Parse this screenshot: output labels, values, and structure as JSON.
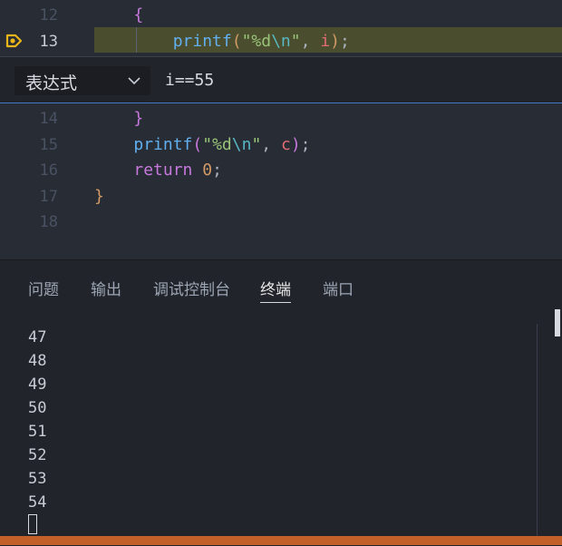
{
  "editor": {
    "lines_top": [
      {
        "num": "12",
        "tokens": [
          {
            "t": "    ",
            "c": "t-plain"
          },
          {
            "t": "{",
            "c": "t-br1"
          }
        ]
      },
      {
        "num": "13",
        "tokens": [
          {
            "t": "        ",
            "c": "t-plain"
          },
          {
            "t": "printf",
            "c": "t-fn"
          },
          {
            "t": "(",
            "c": "t-br2"
          },
          {
            "t": "\"%d",
            "c": "t-str"
          },
          {
            "t": "\\n",
            "c": "t-esc"
          },
          {
            "t": "\"",
            "c": "t-str"
          },
          {
            "t": ", ",
            "c": "t-plain"
          },
          {
            "t": "i",
            "c": "t-var"
          },
          {
            "t": ")",
            "c": "t-br2"
          },
          {
            "t": ";",
            "c": "t-plain"
          }
        ]
      }
    ],
    "lines_bottom": [
      {
        "num": "14",
        "tokens": [
          {
            "t": "    ",
            "c": "t-plain"
          },
          {
            "t": "}",
            "c": "t-br1"
          }
        ]
      },
      {
        "num": "15",
        "tokens": [
          {
            "t": "    ",
            "c": "t-plain"
          },
          {
            "t": "printf",
            "c": "t-fn"
          },
          {
            "t": "(",
            "c": "t-br1"
          },
          {
            "t": "\"%d",
            "c": "t-str"
          },
          {
            "t": "\\n",
            "c": "t-esc"
          },
          {
            "t": "\"",
            "c": "t-str"
          },
          {
            "t": ", ",
            "c": "t-plain"
          },
          {
            "t": "c",
            "c": "t-var"
          },
          {
            "t": ")",
            "c": "t-br1"
          },
          {
            "t": ";",
            "c": "t-plain"
          }
        ]
      },
      {
        "num": "16",
        "tokens": [
          {
            "t": "    ",
            "c": "t-plain"
          },
          {
            "t": "return",
            "c": "t-kw"
          },
          {
            "t": " ",
            "c": "t-plain"
          },
          {
            "t": "0",
            "c": "t-num"
          },
          {
            "t": ";",
            "c": "t-plain"
          }
        ]
      },
      {
        "num": "17",
        "tokens": [
          {
            "t": "}",
            "c": "t-br2"
          }
        ]
      },
      {
        "num": "18",
        "tokens": []
      }
    ],
    "active_line": "13"
  },
  "breakpoint_widget": {
    "type_label": "表达式",
    "condition_value": "i==55"
  },
  "panel": {
    "tabs": [
      {
        "label": "问题",
        "active": false
      },
      {
        "label": "输出",
        "active": false
      },
      {
        "label": "调试控制台",
        "active": false
      },
      {
        "label": "终端",
        "active": true
      },
      {
        "label": "端口",
        "active": false
      }
    ]
  },
  "terminal": {
    "lines": [
      "47",
      "48",
      "49",
      "50",
      "51",
      "52",
      "53",
      "54"
    ]
  },
  "colors": {
    "accent": "#3e7bc4",
    "breakpoint_marker": "#e8b51a",
    "current_line": "#4b4e2e",
    "statusbar": "#c35f28"
  }
}
